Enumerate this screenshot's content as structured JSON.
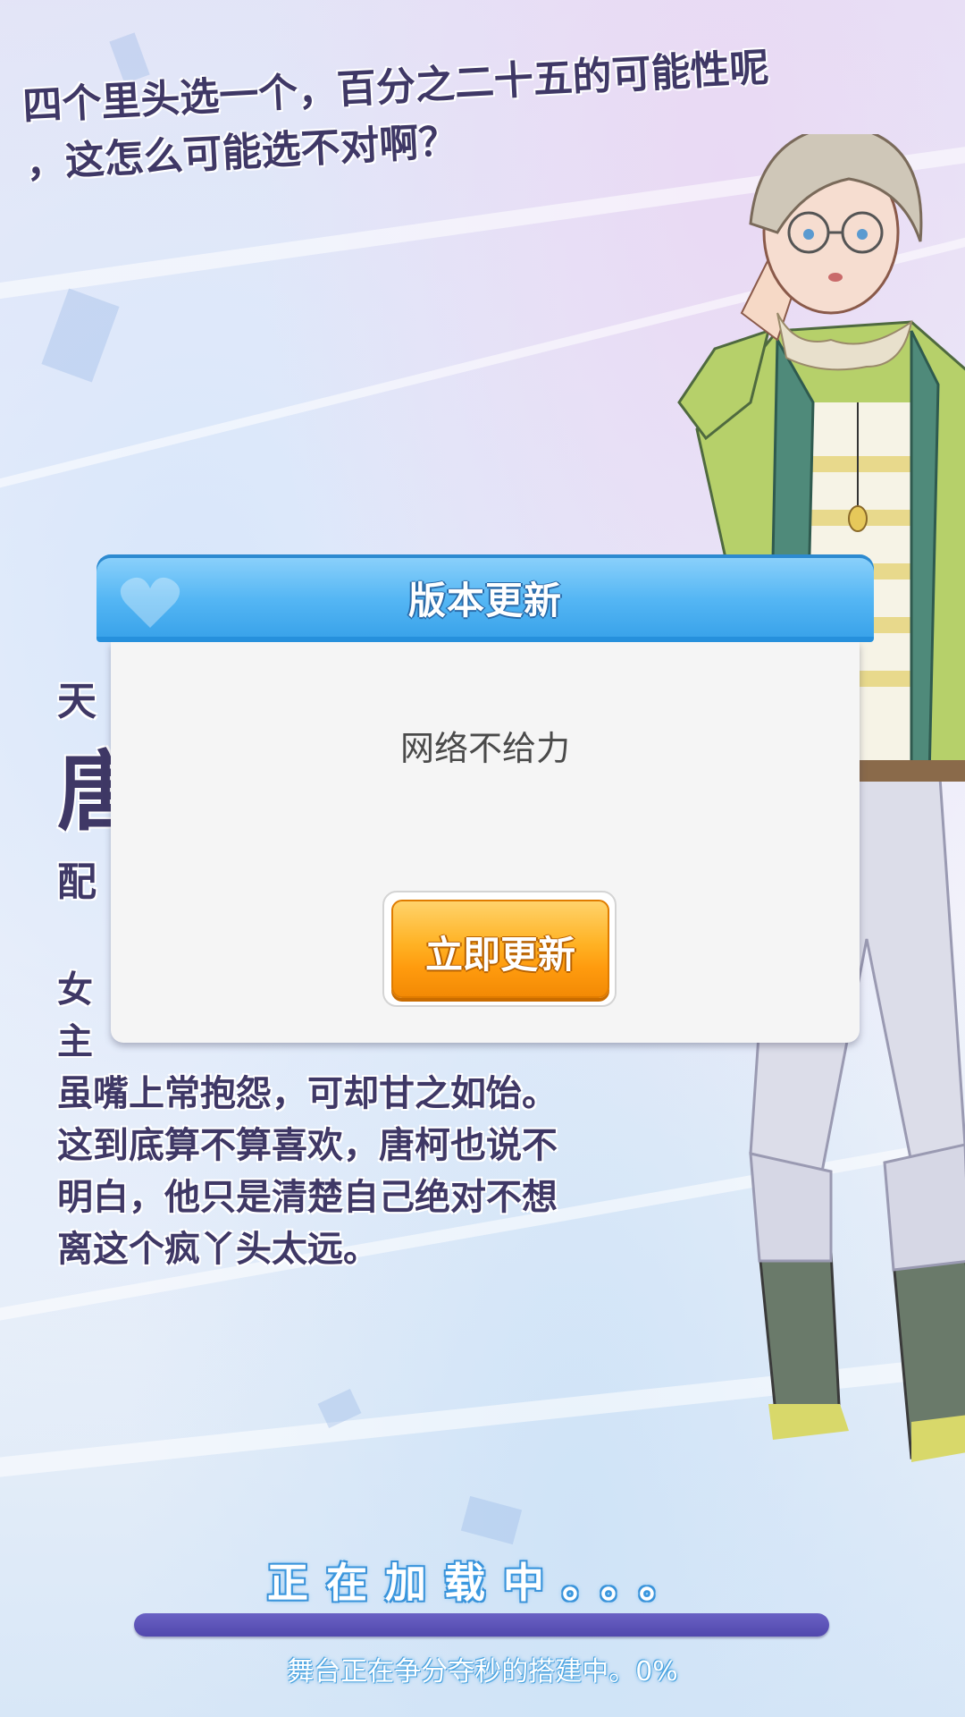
{
  "tagline": {
    "line1": "四个里头选一个，百分之二十五的可能性呢",
    "line2": "，这怎么可能选不对啊？"
  },
  "profile": {
    "label_prefix": "天",
    "name_prefix": "唐",
    "cv_prefix": "配",
    "desc_line1": "女",
    "desc_line2": "主",
    "desc_line3": "虽嘴上常抱怨，可却甘之如饴。",
    "desc_line4": "这到底算不算喜欢，唐柯也说不",
    "desc_line5": "明白，他只是清楚自己绝对不想",
    "desc_line6": "离这个疯丫头太远。"
  },
  "dialog": {
    "title": "版本更新",
    "message": "网络不给力",
    "button_label": "立即更新"
  },
  "loading": {
    "status": "正在加载中。。。",
    "progress_fraction": 0.0,
    "subtitle": "舞台正在争分夺秒的搭建中。0%"
  },
  "colors": {
    "header_blue": "#54b6f4",
    "button_orange": "#ffb224",
    "progress_track": "#5148ad",
    "text_purple": "#3f3866"
  }
}
